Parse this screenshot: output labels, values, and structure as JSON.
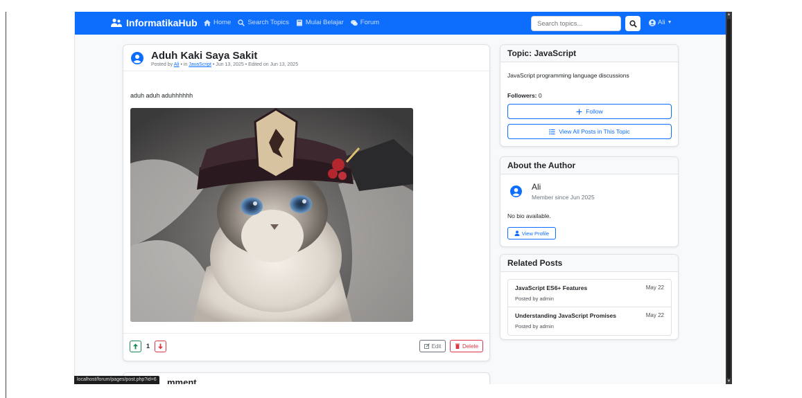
{
  "navbar": {
    "brand": "InformatikaHub",
    "links": [
      "Home",
      "Search Topics",
      "Mulai Belajar",
      "Forum"
    ],
    "search_placeholder": "Search topics...",
    "user": "Ali",
    "color": "#0d6efd"
  },
  "post": {
    "title": "Aduh Kaki Saya Sakit",
    "meta_prefix": "Posted by",
    "author": "Ali",
    "meta_in": "• in",
    "topic": "JavaScript",
    "meta_date": "• Jun 13, 2025 • Edited on Jun 13, 2025",
    "body": "aduh aduh aduhhhhhh",
    "votes": "1",
    "edit_label": "Edit",
    "delete_label": "Delete"
  },
  "comment": {
    "title": "mment"
  },
  "topic_card": {
    "title": "Topic: JavaScript",
    "description": "JavaScript programming language discussions",
    "followers_label": "Followers:",
    "followers_count": "0",
    "follow_label": "Follow",
    "view_all_label": "View All Posts in This Topic"
  },
  "author_card": {
    "title": "About the Author",
    "name": "Ali",
    "since": "Member since Jun 2025",
    "bio": "No bio available.",
    "profile_label": "View Profile"
  },
  "related": {
    "title": "Related Posts",
    "items": [
      {
        "title": "JavaScript ES6+ Features",
        "author": "Posted by admin",
        "date": "May 22"
      },
      {
        "title": "Understanding JavaScript Promises",
        "author": "Posted by admin",
        "date": "May 22"
      }
    ]
  },
  "status_bar": "localhost/forum/pages/post.php?id=6"
}
